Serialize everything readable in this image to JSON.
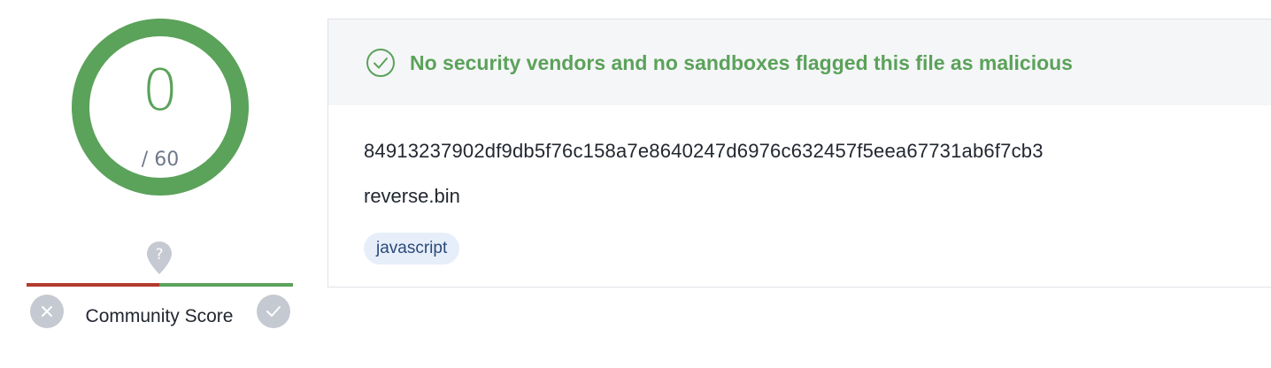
{
  "detection": {
    "score": "0",
    "total": "/ 60",
    "colors": {
      "clean": "#5ba25a",
      "malicious": "#b23b2c",
      "neutral": "#c5c9d1"
    }
  },
  "community": {
    "label": "Community Score",
    "marker_icon": "question-marker-icon",
    "vote_down_icon": "close-icon",
    "vote_up_icon": "checkmark-icon"
  },
  "result": {
    "verdict": "No security vendors and no sandboxes flagged this file as malicious",
    "verdict_icon": "check-circle-icon",
    "hash": "84913237902df9db5f76c158a7e8640247d6976c632457f5eea67731ab6f7cb3",
    "file_name": "reverse.bin",
    "tags": [
      "javascript"
    ]
  }
}
